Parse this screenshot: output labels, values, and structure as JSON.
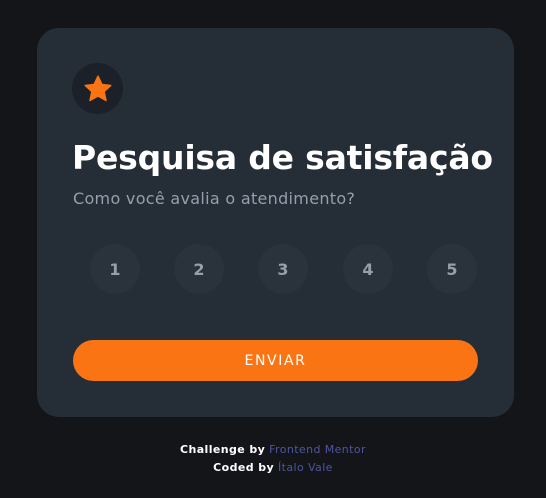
{
  "card": {
    "icon": "star-icon",
    "title": "Pesquisa de satisfação",
    "subtitle": "Como você avalia o atendimento?",
    "ratings": [
      "1",
      "2",
      "3",
      "4",
      "5"
    ],
    "submit_label": "ENVIAR"
  },
  "attribution": {
    "challenge_prefix": "Challenge by",
    "challenge_link": "Frontend Mentor",
    "coded_prefix": "Coded by",
    "coded_link": "Ítalo Vale"
  },
  "colors": {
    "background": "#131518",
    "card": "#252d37",
    "accent": "#fb7413",
    "rating_bg": "#2a323c",
    "muted_text": "#969fad",
    "link": "#4e55a3"
  }
}
